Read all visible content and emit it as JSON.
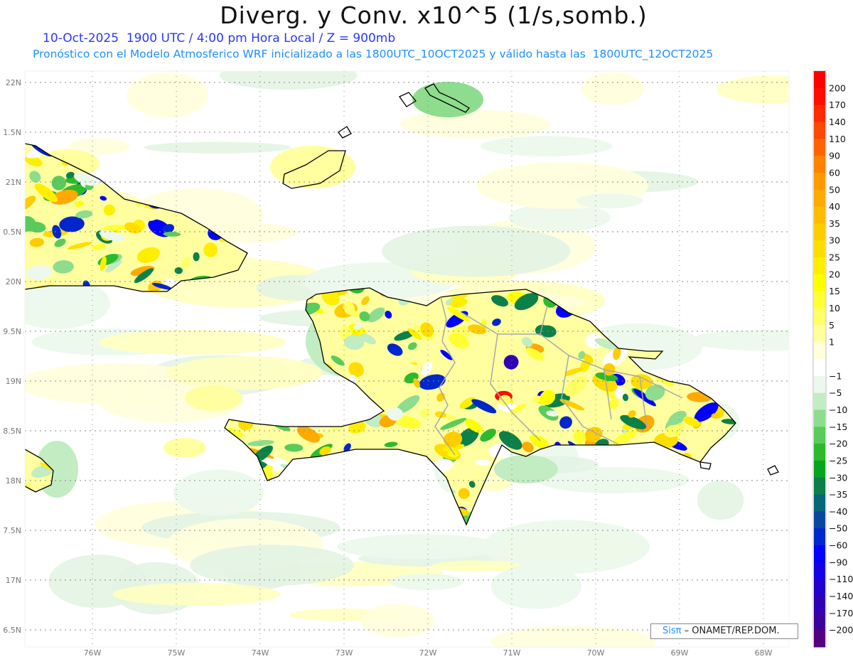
{
  "header": {
    "title": "Diverg. y Conv. x10^5 (1/s,somb.)",
    "subtitle1": "10-Oct-2025  1900 UTC / 4:00 pm Hora Local / Z = 900mb",
    "subtitle2": "Pronóstico con el Modelo Atmosferico WRF inicializado a las 1800UTC_10OCT2025 y válido hasta las  1800UTC_12OCT2025"
  },
  "map": {
    "lat_labels": [
      "22N",
      "1.5N",
      "21N",
      "0.5N",
      "20N",
      "9.5N",
      "19N",
      "8.5N",
      "18N",
      "7.5N",
      "17N",
      "6.5N"
    ],
    "lon_labels": [
      "76W",
      "75W",
      "74W",
      "73W",
      "72W",
      "71W",
      "70W",
      "69W",
      "68W"
    ],
    "regions": [
      "Hispaniola",
      "eastern Cuba",
      "western tip of Jamaica",
      "southern Bahamas / Turks and Caicos",
      "Puerto Rico west islet"
    ]
  },
  "colorbar": {
    "labels": [
      "200",
      "170",
      "140",
      "110",
      "90",
      "60",
      "50",
      "40",
      "35",
      "30",
      "25",
      "20",
      "15",
      "10",
      "5",
      "1",
      "-1",
      "-5",
      "-10",
      "-15",
      "-20",
      "-25",
      "-30",
      "-35",
      "-40",
      "-50",
      "-60",
      "-90",
      "-110",
      "-140",
      "-170",
      "-200"
    ],
    "colors": [
      "#ff0000",
      "#ff0d00",
      "#ff2a00",
      "#ff4800",
      "#ff6400",
      "#ff8200",
      "#ff9b00",
      "#ffaa00",
      "#ffbb00",
      "#ffcc00",
      "#ffdd00",
      "#ffee00",
      "#ffff00",
      "#ffff33",
      "#ffff66",
      "#ffffa0",
      "#ffffdc",
      "#ffffff",
      "#ecf8ec",
      "#c2ecc2",
      "#8edc8e",
      "#5acb5a",
      "#2cba2c",
      "#06a51e",
      "#0b8048",
      "#07667a",
      "#0a46a0",
      "#0026cc",
      "#0000ff",
      "#1400e6",
      "#2200d0",
      "#3000b4",
      "#3e009c",
      "#54007e"
    ]
  },
  "credit": {
    "logo": "Sisπ",
    "text": "– ONAMET/REP.DOM."
  }
}
